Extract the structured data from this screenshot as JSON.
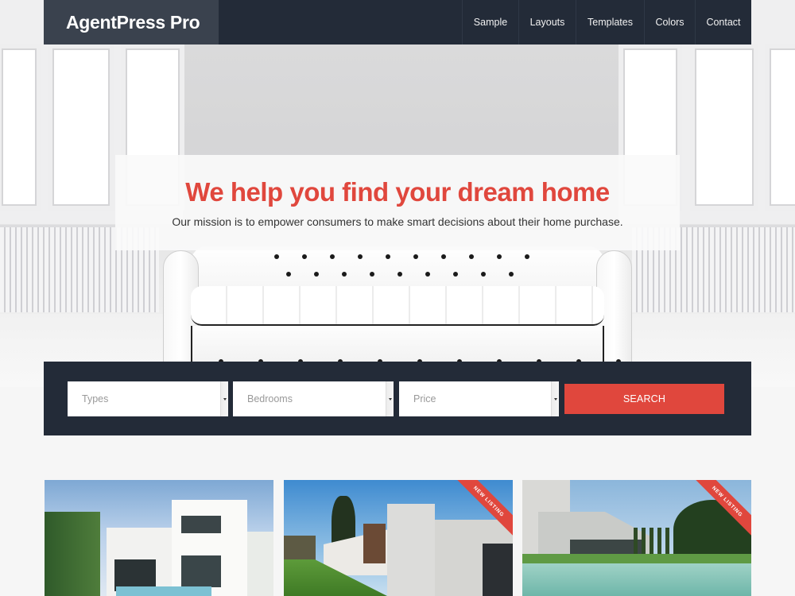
{
  "header": {
    "brand": "AgentPress Pro",
    "nav": [
      {
        "label": "Sample"
      },
      {
        "label": "Layouts"
      },
      {
        "label": "Templates"
      },
      {
        "label": "Colors"
      },
      {
        "label": "Contact"
      }
    ]
  },
  "hero": {
    "title": "We help you find your dream home",
    "subtitle": "Our mission is to empower consumers to make smart decisions about their home purchase."
  },
  "search": {
    "fields": [
      {
        "placeholder": "Types",
        "icon": "chevron-down-icon"
      },
      {
        "placeholder": "Bedrooms",
        "icon": "chevron-down-icon"
      },
      {
        "placeholder": "Price",
        "icon": "chevron-down-icon"
      }
    ],
    "button_label": "SEARCH"
  },
  "listings": [
    {
      "ribbon": null
    },
    {
      "ribbon": "NEW LISTING"
    },
    {
      "ribbon": "NEW LISTING"
    }
  ],
  "colors": {
    "accent": "#e0473d",
    "header_bg": "#232b38",
    "brand_bg": "#3a424e",
    "page_bg": "#f6f6f6"
  }
}
